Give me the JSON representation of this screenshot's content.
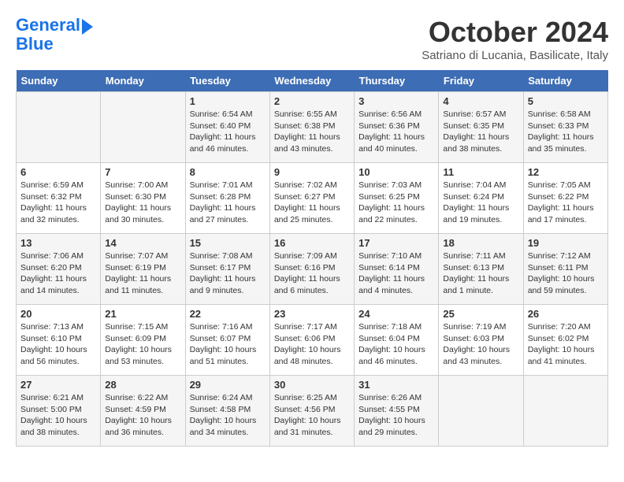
{
  "header": {
    "logo_line1": "General",
    "logo_line2": "Blue",
    "month_title": "October 2024",
    "location": "Satriano di Lucania, Basilicate, Italy"
  },
  "days_of_week": [
    "Sunday",
    "Monday",
    "Tuesday",
    "Wednesday",
    "Thursday",
    "Friday",
    "Saturday"
  ],
  "weeks": [
    [
      {
        "day": null,
        "info": null
      },
      {
        "day": null,
        "info": null
      },
      {
        "day": "1",
        "info": "Sunrise: 6:54 AM\nSunset: 6:40 PM\nDaylight: 11 hours and 46 minutes."
      },
      {
        "day": "2",
        "info": "Sunrise: 6:55 AM\nSunset: 6:38 PM\nDaylight: 11 hours and 43 minutes."
      },
      {
        "day": "3",
        "info": "Sunrise: 6:56 AM\nSunset: 6:36 PM\nDaylight: 11 hours and 40 minutes."
      },
      {
        "day": "4",
        "info": "Sunrise: 6:57 AM\nSunset: 6:35 PM\nDaylight: 11 hours and 38 minutes."
      },
      {
        "day": "5",
        "info": "Sunrise: 6:58 AM\nSunset: 6:33 PM\nDaylight: 11 hours and 35 minutes."
      }
    ],
    [
      {
        "day": "6",
        "info": "Sunrise: 6:59 AM\nSunset: 6:32 PM\nDaylight: 11 hours and 32 minutes."
      },
      {
        "day": "7",
        "info": "Sunrise: 7:00 AM\nSunset: 6:30 PM\nDaylight: 11 hours and 30 minutes."
      },
      {
        "day": "8",
        "info": "Sunrise: 7:01 AM\nSunset: 6:28 PM\nDaylight: 11 hours and 27 minutes."
      },
      {
        "day": "9",
        "info": "Sunrise: 7:02 AM\nSunset: 6:27 PM\nDaylight: 11 hours and 25 minutes."
      },
      {
        "day": "10",
        "info": "Sunrise: 7:03 AM\nSunset: 6:25 PM\nDaylight: 11 hours and 22 minutes."
      },
      {
        "day": "11",
        "info": "Sunrise: 7:04 AM\nSunset: 6:24 PM\nDaylight: 11 hours and 19 minutes."
      },
      {
        "day": "12",
        "info": "Sunrise: 7:05 AM\nSunset: 6:22 PM\nDaylight: 11 hours and 17 minutes."
      }
    ],
    [
      {
        "day": "13",
        "info": "Sunrise: 7:06 AM\nSunset: 6:20 PM\nDaylight: 11 hours and 14 minutes."
      },
      {
        "day": "14",
        "info": "Sunrise: 7:07 AM\nSunset: 6:19 PM\nDaylight: 11 hours and 11 minutes."
      },
      {
        "day": "15",
        "info": "Sunrise: 7:08 AM\nSunset: 6:17 PM\nDaylight: 11 hours and 9 minutes."
      },
      {
        "day": "16",
        "info": "Sunrise: 7:09 AM\nSunset: 6:16 PM\nDaylight: 11 hours and 6 minutes."
      },
      {
        "day": "17",
        "info": "Sunrise: 7:10 AM\nSunset: 6:14 PM\nDaylight: 11 hours and 4 minutes."
      },
      {
        "day": "18",
        "info": "Sunrise: 7:11 AM\nSunset: 6:13 PM\nDaylight: 11 hours and 1 minute."
      },
      {
        "day": "19",
        "info": "Sunrise: 7:12 AM\nSunset: 6:11 PM\nDaylight: 10 hours and 59 minutes."
      }
    ],
    [
      {
        "day": "20",
        "info": "Sunrise: 7:13 AM\nSunset: 6:10 PM\nDaylight: 10 hours and 56 minutes."
      },
      {
        "day": "21",
        "info": "Sunrise: 7:15 AM\nSunset: 6:09 PM\nDaylight: 10 hours and 53 minutes."
      },
      {
        "day": "22",
        "info": "Sunrise: 7:16 AM\nSunset: 6:07 PM\nDaylight: 10 hours and 51 minutes."
      },
      {
        "day": "23",
        "info": "Sunrise: 7:17 AM\nSunset: 6:06 PM\nDaylight: 10 hours and 48 minutes."
      },
      {
        "day": "24",
        "info": "Sunrise: 7:18 AM\nSunset: 6:04 PM\nDaylight: 10 hours and 46 minutes."
      },
      {
        "day": "25",
        "info": "Sunrise: 7:19 AM\nSunset: 6:03 PM\nDaylight: 10 hours and 43 minutes."
      },
      {
        "day": "26",
        "info": "Sunrise: 7:20 AM\nSunset: 6:02 PM\nDaylight: 10 hours and 41 minutes."
      }
    ],
    [
      {
        "day": "27",
        "info": "Sunrise: 6:21 AM\nSunset: 5:00 PM\nDaylight: 10 hours and 38 minutes."
      },
      {
        "day": "28",
        "info": "Sunrise: 6:22 AM\nSunset: 4:59 PM\nDaylight: 10 hours and 36 minutes."
      },
      {
        "day": "29",
        "info": "Sunrise: 6:24 AM\nSunset: 4:58 PM\nDaylight: 10 hours and 34 minutes."
      },
      {
        "day": "30",
        "info": "Sunrise: 6:25 AM\nSunset: 4:56 PM\nDaylight: 10 hours and 31 minutes."
      },
      {
        "day": "31",
        "info": "Sunrise: 6:26 AM\nSunset: 4:55 PM\nDaylight: 10 hours and 29 minutes."
      },
      {
        "day": null,
        "info": null
      },
      {
        "day": null,
        "info": null
      }
    ]
  ]
}
